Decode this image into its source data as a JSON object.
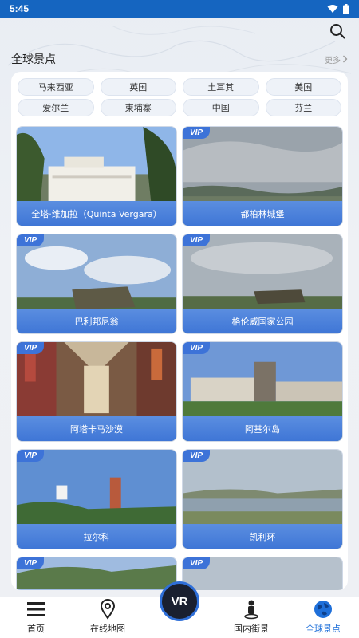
{
  "status": {
    "time": "5:45"
  },
  "header": {
    "title": "全球景点",
    "more_label": "更多"
  },
  "chips": [
    "马来西亚",
    "英国",
    "土耳其",
    "美国",
    "爱尔兰",
    "柬埔寨",
    "中国",
    "芬兰"
  ],
  "vip_label": "VIP",
  "tiles": [
    {
      "name": "全塔·维加拉（Quinta Vergara）",
      "vip": false
    },
    {
      "name": "都柏林城堡",
      "vip": true
    },
    {
      "name": "巴利邦尼翁",
      "vip": true
    },
    {
      "name": "格伦威国家公园",
      "vip": true
    },
    {
      "name": "阿塔卡马沙漠",
      "vip": true
    },
    {
      "name": "阿基尔岛",
      "vip": true
    },
    {
      "name": "拉尔科",
      "vip": true
    },
    {
      "name": "凯利环",
      "vip": true
    }
  ],
  "nav": {
    "home": "首页",
    "map": "在线地图",
    "vr": "VR",
    "domestic": "国内街景",
    "global": "全球景点"
  },
  "colors": {
    "accent": "#1e6fd9",
    "caption": "#4a80dc",
    "status_bar": "#1565c0"
  }
}
